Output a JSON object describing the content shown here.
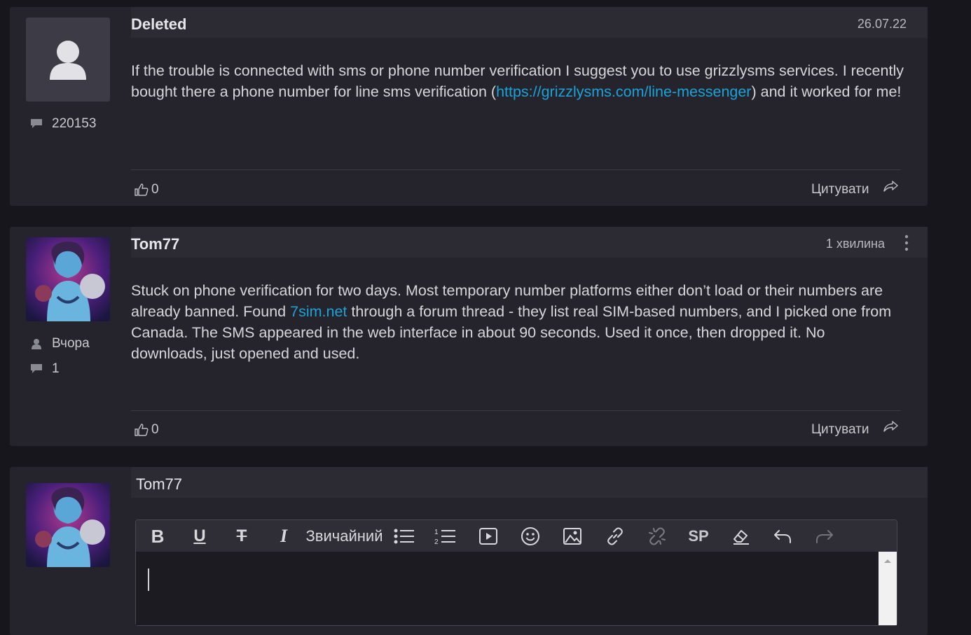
{
  "posts": [
    {
      "author": "Deleted",
      "date": "26.07.22",
      "message_count": "220153",
      "body_parts": [
        "If the trouble is connected with sms or phone number verification I suggest you to use grizzlysms services. I recently bought there a phone number for line sms verification (",
        "https://grizzlysms.com/line-messenger",
        ") and it worked for me!"
      ],
      "likes": "0",
      "quote_label": "Цитувати"
    },
    {
      "author": "Tom77",
      "date": "1 хвилина",
      "last_seen": "Вчора",
      "message_count": "1",
      "body_parts": [
        "Stuck on phone verification for two days. Most temporary number platforms either don’t load or their numbers are already banned. Found ",
        "7sim.net",
        " through  a forum thread - they list real SIM-based numbers, and I picked one from Canada. The SMS appeared in the web interface in about 90 seconds. Used it once, then dropped it. No downloads, just opened and used."
      ],
      "likes": "0",
      "quote_label": "Цитувати"
    }
  ],
  "reply": {
    "author": "Tom77",
    "toolbar": {
      "bold": "B",
      "underline": "U",
      "strike": "T",
      "italic": "I",
      "format_select": "Звичайний",
      "spoiler": "SP"
    }
  },
  "colors": {
    "background": "#17161c",
    "card": "#25242c",
    "link": "#1aa3d9"
  }
}
